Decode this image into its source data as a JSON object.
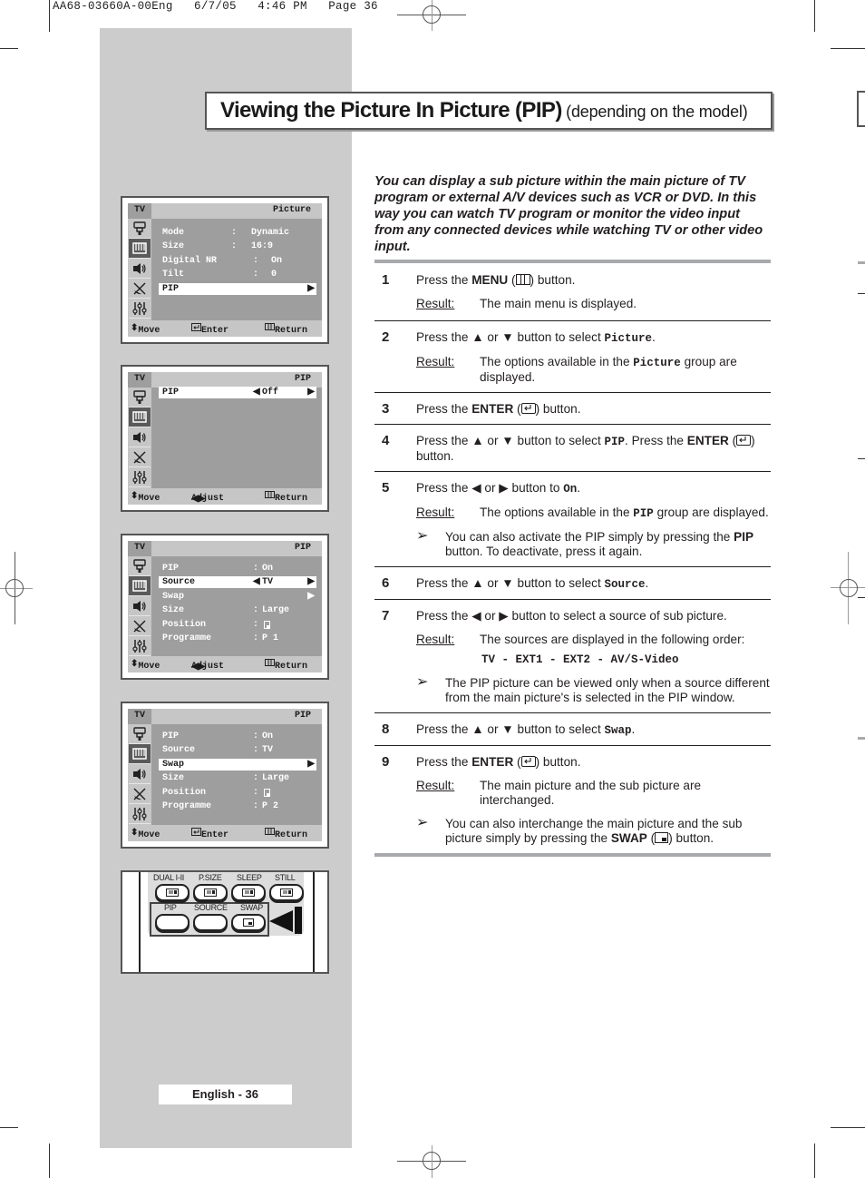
{
  "print_header": "AA68-03660A-00Eng   6/7/05   4:46 PM   Page 36",
  "title": {
    "main": "Viewing the Picture In Picture (PIP)",
    "sub": "(depending on the model)"
  },
  "intro": "You can display a sub picture within the main picture of TV program or external A/V devices such as VCR or DVD. In this way you can watch TV program or monitor the video input from any connected devices while watching TV or other video input.",
  "menu_icons": [
    "input-icon",
    "picture-icon",
    "sound-icon",
    "channel-icon",
    "setup-icon"
  ],
  "screens": [
    {
      "source_label": "TV",
      "title": "Picture",
      "rows": [
        {
          "key": "Mode",
          "sep": ":",
          "value": "Dynamic"
        },
        {
          "key": "Size",
          "sep": ":",
          "value": "16:9"
        },
        {
          "key": "Digital NR",
          "sep": ":",
          "value": "On"
        },
        {
          "key": "Tilt",
          "sep": ":",
          "value": "0"
        },
        {
          "key": "PIP",
          "sep": "",
          "value": "",
          "highlighted": true,
          "arrow": "▶"
        }
      ],
      "footer": {
        "move": "Move",
        "action": "Enter",
        "return": "Return"
      }
    },
    {
      "source_label": "TV",
      "title": "PIP",
      "rows": [
        {
          "key": "PIP",
          "sep": "◀",
          "value": "Off",
          "highlighted": true,
          "arrow": "▶"
        }
      ],
      "footer": {
        "move": "Move",
        "action": "Adjust",
        "return": "Return"
      }
    },
    {
      "source_label": "TV",
      "title": "PIP",
      "rows": [
        {
          "key": "PIP",
          "sep": ":",
          "value": "On"
        },
        {
          "key": "Source",
          "sep": "◀",
          "value": "TV",
          "highlighted": true,
          "arrow": "▶"
        },
        {
          "key": "Swap",
          "sep": "",
          "value": "",
          "arrow": "▶"
        },
        {
          "key": "Size",
          "sep": ":",
          "value": "Large"
        },
        {
          "key": "Position",
          "sep": ":",
          "value": "",
          "position_icon": true
        },
        {
          "key": "Programme",
          "sep": ":",
          "value": "P 1"
        }
      ],
      "footer": {
        "move": "Move",
        "action": "Adjust",
        "return": "Return"
      }
    },
    {
      "source_label": "TV",
      "title": "PIP",
      "rows": [
        {
          "key": "PIP",
          "sep": ":",
          "value": "On"
        },
        {
          "key": "Source",
          "sep": ":",
          "value": "TV"
        },
        {
          "key": "Swap",
          "sep": "",
          "value": "",
          "highlighted": true,
          "arrow": "▶"
        },
        {
          "key": "Size",
          "sep": ":",
          "value": "Large"
        },
        {
          "key": "Position",
          "sep": ":",
          "value": "",
          "position_icon": true
        },
        {
          "key": "Programme",
          "sep": ":",
          "value": "P 2"
        }
      ],
      "footer": {
        "move": "Move",
        "action": "Enter",
        "return": "Return"
      }
    }
  ],
  "remote": {
    "row1": [
      "DUAL I-II",
      "P.SIZE",
      "SLEEP",
      "STILL"
    ],
    "row2": [
      "PIP",
      "SOURCE",
      "SWAP"
    ]
  },
  "steps": [
    {
      "num": "1",
      "text_parts": [
        {
          "t": "Press the "
        },
        {
          "t": "MENU",
          "s": "bold"
        },
        {
          "t": " ("
        },
        {
          "t": "menu",
          "s": "icon"
        },
        {
          "t": ") button."
        }
      ],
      "result": "The main menu is displayed."
    },
    {
      "num": "2",
      "text_parts": [
        {
          "t": "Press the ▲ or ▼ button to select "
        },
        {
          "t": "Picture",
          "s": "mono"
        },
        {
          "t": "."
        }
      ],
      "result_parts": [
        {
          "t": "The options available in the "
        },
        {
          "t": "Picture",
          "s": "mono"
        },
        {
          "t": " group are displayed."
        }
      ]
    },
    {
      "num": "3",
      "text_parts": [
        {
          "t": "Press the "
        },
        {
          "t": "ENTER",
          "s": "bold"
        },
        {
          "t": " ("
        },
        {
          "t": "enter",
          "s": "icon"
        },
        {
          "t": ") button."
        }
      ]
    },
    {
      "num": "4",
      "text_parts": [
        {
          "t": "Press the ▲ or ▼  button to select "
        },
        {
          "t": "PIP",
          "s": "mono"
        },
        {
          "t": ". Press the "
        },
        {
          "t": "ENTER",
          "s": "bold"
        },
        {
          "t": " ("
        },
        {
          "t": "enter",
          "s": "icon"
        },
        {
          "t": ") button."
        }
      ]
    },
    {
      "num": "5",
      "text_parts": [
        {
          "t": "Press the ◀ or ▶ button to "
        },
        {
          "t": "On",
          "s": "mono"
        },
        {
          "t": "."
        }
      ],
      "result_parts": [
        {
          "t": "The options available in the "
        },
        {
          "t": "PIP",
          "s": "mono"
        },
        {
          "t": " group are displayed."
        }
      ],
      "note_parts": [
        {
          "t": "You can also activate the PIP simply by pressing the "
        },
        {
          "t": "PIP",
          "s": "bold"
        },
        {
          "t": " button. To deactivate, press it again."
        }
      ]
    },
    {
      "num": "6",
      "text_parts": [
        {
          "t": "Press the ▲ or ▼ button to select "
        },
        {
          "t": "Source",
          "s": "mono"
        },
        {
          "t": "."
        }
      ]
    },
    {
      "num": "7",
      "text_parts": [
        {
          "t": "Press the ◀ or ▶ button to select a source of sub picture."
        }
      ],
      "result": "The sources are displayed in the following order:",
      "result_extra": "TV - EXT1 - EXT2 - AV/S-Video",
      "note_parts": [
        {
          "t": "The PIP picture can be viewed only when a source different from the main picture's is selected in the PIP window."
        }
      ]
    },
    {
      "num": "8",
      "text_parts": [
        {
          "t": "Press the ▲ or ▼ button to select "
        },
        {
          "t": "Swap",
          "s": "mono"
        },
        {
          "t": "."
        }
      ]
    },
    {
      "num": "9",
      "text_parts": [
        {
          "t": "Press the "
        },
        {
          "t": "ENTER",
          "s": "bold"
        },
        {
          "t": " ("
        },
        {
          "t": "enter",
          "s": "icon"
        },
        {
          "t": ") button."
        }
      ],
      "result": "The main picture and the sub picture are interchanged.",
      "note_parts": [
        {
          "t": "You can also interchange the main picture and the sub picture simply by pressing the "
        },
        {
          "t": "SWAP",
          "s": "bold"
        },
        {
          "t": " ("
        },
        {
          "t": "swap",
          "s": "icon"
        },
        {
          "t": ") button."
        }
      ]
    }
  ],
  "labels": {
    "result": "Result:",
    "note_arrow": "➢"
  },
  "page_number": "English - 36"
}
